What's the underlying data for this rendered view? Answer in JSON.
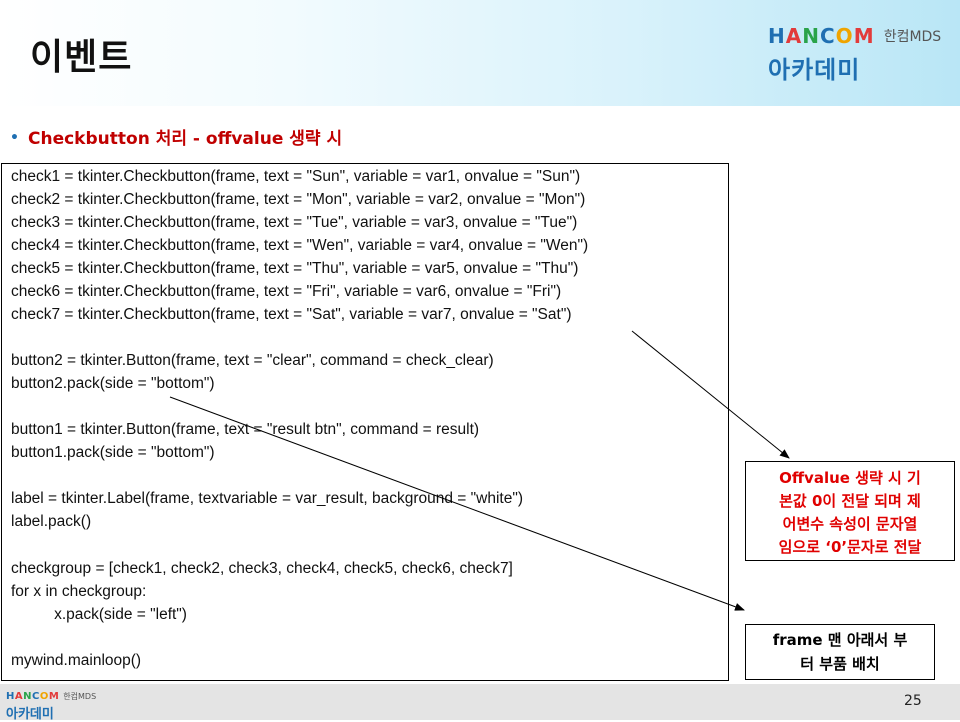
{
  "header": {
    "title": "이벤트",
    "logo_hancom": "HANCOM",
    "logo_mds": "한컴MDS",
    "logo_academy": "아카데미"
  },
  "bullet": {
    "marker": "•",
    "text": "Checkbutton 처리 - offvalue 생략 시"
  },
  "code_lines": [
    "check1 = tkinter.Checkbutton(frame, text = \"Sun\", variable = var1, onvalue = \"Sun\")",
    "check2 = tkinter.Checkbutton(frame, text = \"Mon\", variable = var2, onvalue = \"Mon\")",
    "check3 = tkinter.Checkbutton(frame, text = \"Tue\", variable = var3, onvalue = \"Tue\")",
    "check4 = tkinter.Checkbutton(frame, text = \"Wen\", variable = var4, onvalue = \"Wen\")",
    "check5 = tkinter.Checkbutton(frame, text = \"Thu\", variable = var5, onvalue = \"Thu\")",
    "check6 = tkinter.Checkbutton(frame, text = \"Fri\", variable = var6, onvalue = \"Fri\")",
    "check7 = tkinter.Checkbutton(frame, text = \"Sat\", variable = var7, onvalue = \"Sat\")",
    "button2 = tkinter.Button(frame, text = \"clear\", command = check_clear)",
    "button2.pack(side = \"bottom\")",
    "button1 = tkinter.Button(frame, text = \"result btn\", command = result)",
    "button1.pack(side = \"bottom\")",
    "label = tkinter.Label(frame, textvariable = var_result, background = \"white\")",
    "label.pack()",
    "checkgroup = [check1, check2, check3, check4, check5, check6, check7]",
    "for x in checkgroup:",
    "          x.pack(side = \"left\")",
    "mywind.mainloop()"
  ],
  "callouts": {
    "offvalue_note_lines": [
      "Offvalue 생략 시 기",
      "본값 0이 전달 되며 제",
      "어변수 속성이 문자열",
      "임으로 ‘0’문자로 전달"
    ],
    "frame_note_lines": [
      "frame 맨 아래서 부",
      "터 부품 배치"
    ]
  },
  "footer": {
    "logo_hancom": "HANCOM",
    "logo_mds": "한컴MDS",
    "logo_academy": "아카데미",
    "page_number": "25"
  },
  "colors": {
    "accent_red": "#c00000",
    "callout_red": "#e00000",
    "academy_blue": "#1f6fb2"
  }
}
